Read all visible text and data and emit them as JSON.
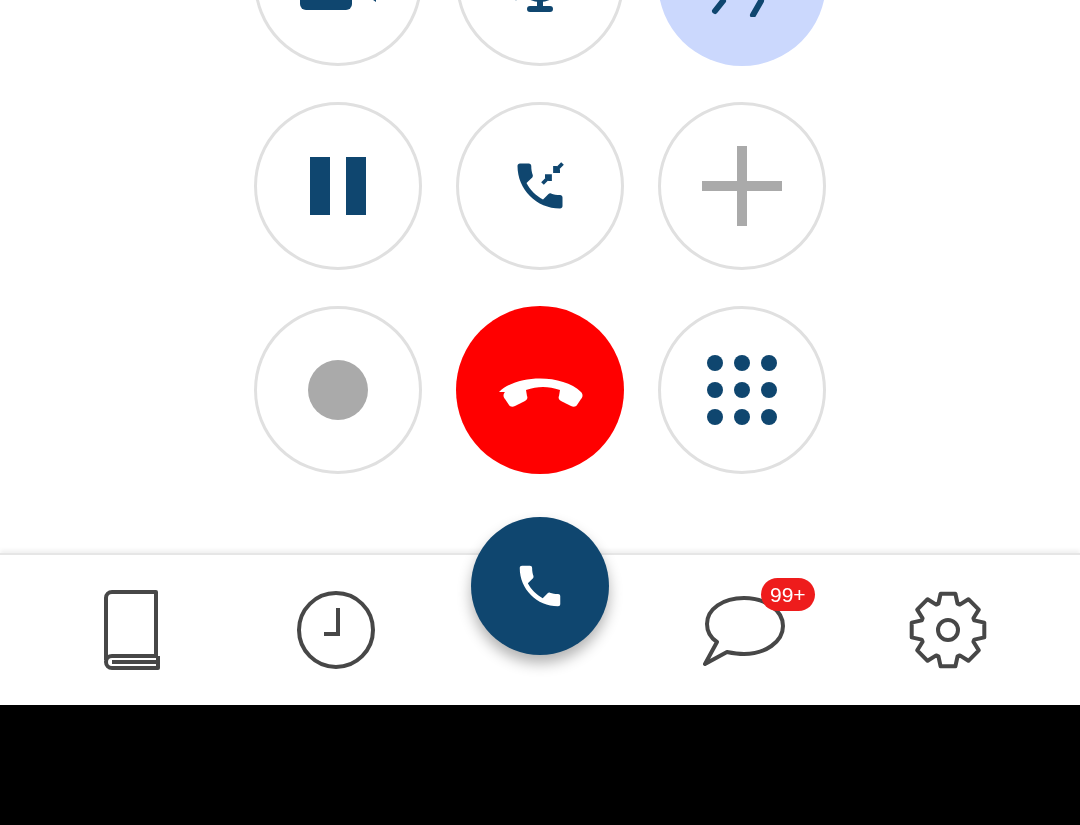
{
  "call_controls": [
    {
      "kind": "video",
      "on": false,
      "disabled": false
    },
    {
      "kind": "mute",
      "on": false,
      "disabled": false
    },
    {
      "kind": "speaker",
      "on": true,
      "disabled": false
    },
    {
      "kind": "hold",
      "on": false,
      "disabled": false
    },
    {
      "kind": "merge",
      "on": false,
      "disabled": false
    },
    {
      "kind": "add",
      "on": false,
      "disabled": true
    },
    {
      "kind": "record",
      "on": false,
      "disabled": true
    },
    {
      "kind": "hangup",
      "on": false,
      "disabled": false
    },
    {
      "kind": "keypad",
      "on": false,
      "disabled": false
    }
  ],
  "nav": [
    {
      "kind": "contacts",
      "selected": false
    },
    {
      "kind": "history",
      "selected": false
    },
    {
      "kind": "call",
      "selected": true
    },
    {
      "kind": "messages",
      "selected": false,
      "badge": "99+"
    },
    {
      "kind": "settings",
      "selected": false
    }
  ]
}
